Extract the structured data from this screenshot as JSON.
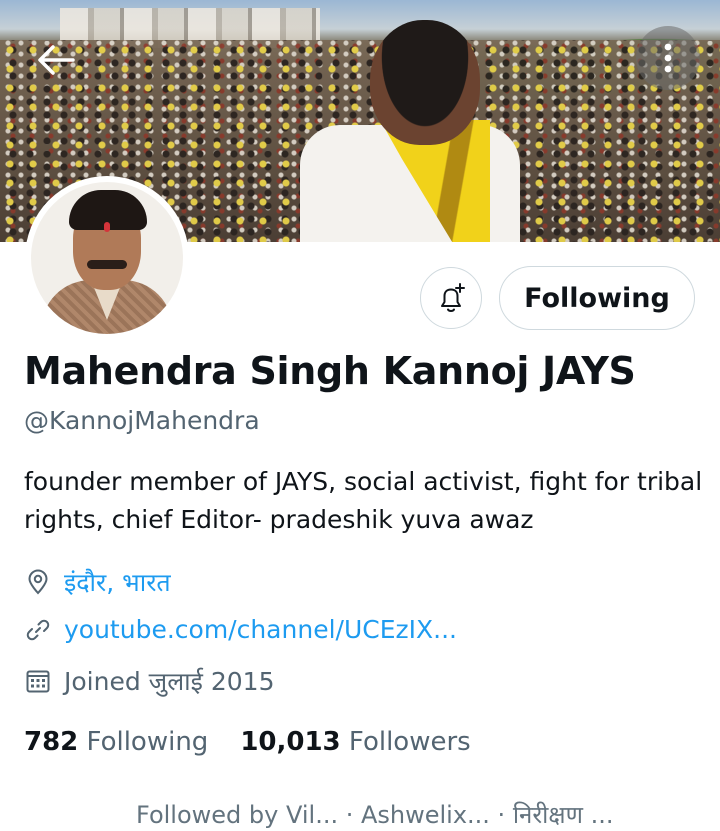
{
  "header": {
    "back_icon": "arrow-left-icon",
    "more_icon": "more-vertical-icon"
  },
  "profile": {
    "display_name": "Mahendra Singh Kannoj JAYS",
    "handle": "@KannojMahendra",
    "bio": "founder member of JAYS, social activist, fight for tribal rights, chief Editor- pradeshik yuva awaz",
    "location": "इंदौर, भारत",
    "website": "youtube.com/channel/UCEzIX...",
    "joined": "Joined जुलाई 2015",
    "following_count": "782",
    "following_label": "Following",
    "followers_count": "10,013",
    "followers_label": "Followers",
    "followed_by": "Followed by Vil... · Ashwelix... · निरीक्षण ..."
  },
  "actions": {
    "notify_icon": "bell-plus-icon",
    "follow_button_label": "Following"
  },
  "colors": {
    "accent": "#1d9bf0",
    "secondary_text": "#536471",
    "border": "#cfd9de"
  }
}
